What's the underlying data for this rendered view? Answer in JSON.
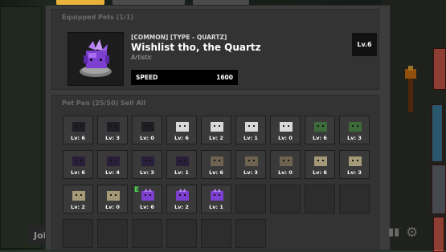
{
  "equipped": {
    "section_label": "Equipped Pets",
    "section_count": "(1/1)",
    "tag": "[COMMON] [TYPE - QUARTZ]",
    "name": "Wishlist tho, the Quartz",
    "trait": "Artistic",
    "stat_label": "SPEED",
    "stat_value": "1600",
    "level": "Lv.6"
  },
  "pen": {
    "section_label": "Pet Pen",
    "section_count": "(25/50)",
    "extra": "Sell All",
    "pets": [
      {
        "kind": "dark",
        "level": "Lv: 6",
        "new": false
      },
      {
        "kind": "dark",
        "level": "Lv: 3",
        "new": false
      },
      {
        "kind": "dark",
        "level": "Lv: 0",
        "new": false
      },
      {
        "kind": "white",
        "level": "Lv: 6",
        "new": false
      },
      {
        "kind": "white",
        "level": "Lv: 2",
        "new": false
      },
      {
        "kind": "white",
        "level": "Lv: 1",
        "new": false
      },
      {
        "kind": "white",
        "level": "Lv: 0",
        "new": false
      },
      {
        "kind": "green",
        "level": "Lv: 6",
        "new": false
      },
      {
        "kind": "green",
        "level": "Lv: 3",
        "new": false
      },
      {
        "kind": "shadow",
        "level": "Lv: 6",
        "new": false
      },
      {
        "kind": "shadow",
        "level": "Lv: 4",
        "new": false
      },
      {
        "kind": "shadow",
        "level": "Lv: 3",
        "new": false
      },
      {
        "kind": "shadow",
        "level": "Lv: 1",
        "new": false
      },
      {
        "kind": "rock",
        "level": "Lv: 6",
        "new": false
      },
      {
        "kind": "rock",
        "level": "Lv: 3",
        "new": false
      },
      {
        "kind": "rock",
        "level": "Lv: 0",
        "new": false
      },
      {
        "kind": "tan",
        "level": "Lv: 6",
        "new": false
      },
      {
        "kind": "tan",
        "level": "Lv: 3",
        "new": false
      },
      {
        "kind": "tan",
        "level": "Lv: 2",
        "new": false
      },
      {
        "kind": "tan",
        "level": "Lv: 0",
        "new": false
      },
      {
        "kind": "quartz",
        "level": "Lv: 6",
        "new": true
      },
      {
        "kind": "quartz",
        "level": "Lv: 2",
        "new": false
      },
      {
        "kind": "quartz",
        "level": "Lv: 1",
        "new": false
      }
    ],
    "empty_slots": 10,
    "new_label": "E"
  },
  "background": {
    "join_button": "Joi"
  },
  "colors": {
    "dark": "#1e1e24",
    "white": "#d9d9d9",
    "green": "#3d6a3a",
    "shadow": "#2a1f3a",
    "rock": "#6e6250",
    "tan": "#a59a78",
    "quartz": "#7c3fd0"
  }
}
